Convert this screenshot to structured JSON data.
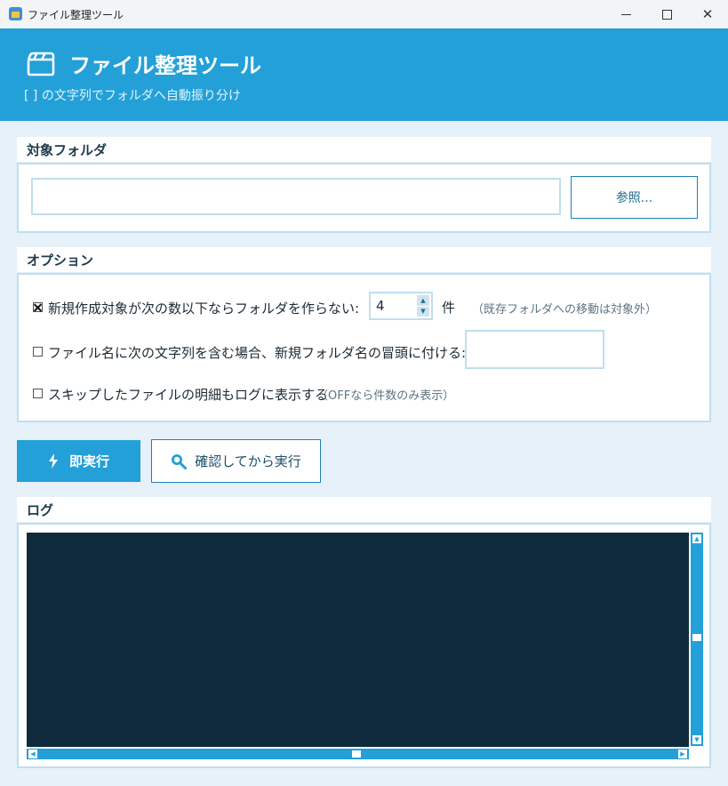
{
  "window": {
    "title": "ファイル整理ツール",
    "minimize_glyph": "",
    "maximize_glyph": "",
    "close_glyph": "✕"
  },
  "header": {
    "title": "ファイル整理ツール",
    "subtitle": "[ ] の文字列でフォルダへ自動振り分け",
    "icon": "clapperboard-icon"
  },
  "target_folder": {
    "label": "対象フォルダ",
    "path_value": "",
    "browse_label": "参照..."
  },
  "options": {
    "label": "オプション",
    "skip_small": {
      "checked": true,
      "label": "新規作成対象が次の数以下ならフォルダを作らない:",
      "value": "4",
      "unit": "件",
      "note": "（既存フォルダへの移動は対象外）"
    },
    "prefix": {
      "checked": false,
      "label": "ファイル名に次の文字列を含む場合、新規フォルダ名の冒頭に付ける:",
      "value": ""
    },
    "log_skipped": {
      "checked": false,
      "label": "スキップしたファイルの明細もログに表示する",
      "note": "（OFFなら件数のみ表示）"
    }
  },
  "actions": {
    "run_label": "即実行",
    "run_icon": "lightning-icon",
    "confirm_label": "確認してから実行",
    "confirm_icon": "magnifier-icon"
  },
  "log": {
    "label": "ログ",
    "content": ""
  },
  "colors": {
    "accent": "#23a0d8",
    "log_background": "#0f2a3c",
    "panel_border": "#bfdfee",
    "page_background": "#e6f1f9"
  }
}
